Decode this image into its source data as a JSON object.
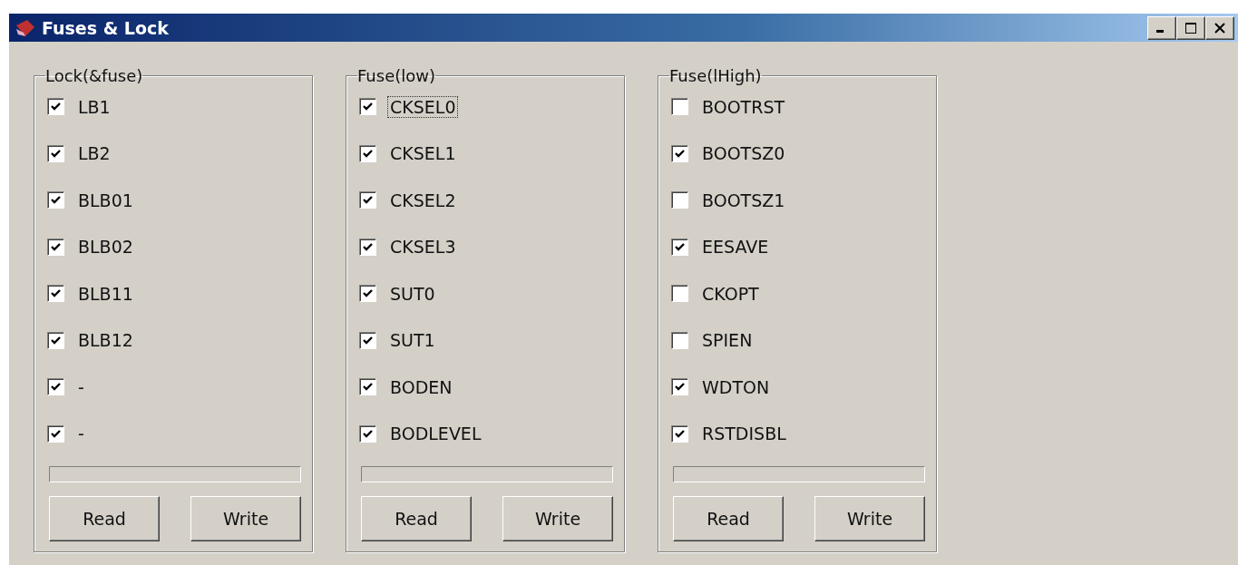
{
  "window": {
    "title": "Fuses & Lock"
  },
  "groups": [
    {
      "title": "Lock(&fuse)",
      "items": [
        {
          "label": "LB1",
          "checked": true,
          "focused": false
        },
        {
          "label": "LB2",
          "checked": true,
          "focused": false
        },
        {
          "label": "BLB01",
          "checked": true,
          "focused": false
        },
        {
          "label": "BLB02",
          "checked": true,
          "focused": false
        },
        {
          "label": "BLB11",
          "checked": true,
          "focused": false
        },
        {
          "label": "BLB12",
          "checked": true,
          "focused": false
        },
        {
          "label": "-",
          "checked": true,
          "focused": false
        },
        {
          "label": "-",
          "checked": true,
          "focused": false
        }
      ],
      "progress": {
        "level": 0
      },
      "buttons": [
        "Read",
        "Write"
      ]
    },
    {
      "title": "Fuse(low)",
      "items": [
        {
          "label": "CKSEL0",
          "checked": true,
          "focused": true
        },
        {
          "label": "CKSEL1",
          "checked": true,
          "focused": false
        },
        {
          "label": "CKSEL2",
          "checked": true,
          "focused": false
        },
        {
          "label": "CKSEL3",
          "checked": true,
          "focused": false
        },
        {
          "label": "SUT0",
          "checked": true,
          "focused": false
        },
        {
          "label": "SUT1",
          "checked": true,
          "focused": false
        },
        {
          "label": "BODEN",
          "checked": true,
          "focused": false
        },
        {
          "label": "BODLEVEL",
          "checked": true,
          "focused": false
        }
      ],
      "progress": {
        "level": 0
      },
      "buttons": [
        "Read",
        "Write"
      ]
    },
    {
      "title": "Fuse(lHigh)",
      "items": [
        {
          "label": "BOOTRST",
          "checked": false,
          "focused": false
        },
        {
          "label": "BOOTSZ0",
          "checked": true,
          "focused": false
        },
        {
          "label": "BOOTSZ1",
          "checked": false,
          "focused": false
        },
        {
          "label": "EESAVE",
          "checked": true,
          "focused": false
        },
        {
          "label": "CKOPT",
          "checked": false,
          "focused": false
        },
        {
          "label": "SPIEN",
          "checked": false,
          "focused": false
        },
        {
          "label": "WDTON",
          "checked": true,
          "focused": false
        },
        {
          "label": "RSTDISBL",
          "checked": true,
          "focused": false
        }
      ],
      "progress": {
        "level": 0
      },
      "buttons": [
        "Read",
        "Write"
      ]
    }
  ]
}
